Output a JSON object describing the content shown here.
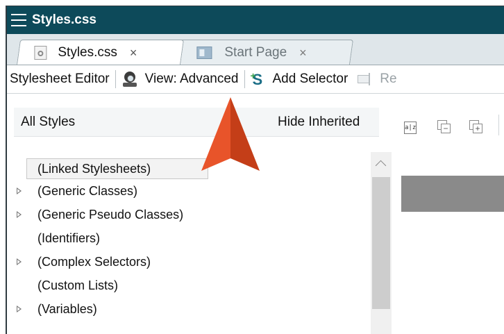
{
  "window": {
    "title": "Styles.css"
  },
  "tabs": [
    {
      "label": "Styles.css",
      "close": "×",
      "icon": "css-file-icon",
      "active": true
    },
    {
      "label": "Start Page",
      "close": "×",
      "icon": "start-page-icon",
      "active": false
    }
  ],
  "toolbar": {
    "stylesheet_editor": "Stylesheet Editor",
    "view_label": "View: Advanced",
    "add_selector": "Add Selector",
    "rename_partial": "Re"
  },
  "filter": {
    "value": "All Styles",
    "hide_inherited": "Hide Inherited",
    "sort_icon_text": "a|z"
  },
  "tree": {
    "items": [
      {
        "label": "(Linked Stylesheets)",
        "expandable": false,
        "selected": true
      },
      {
        "label": "(Generic Classes)",
        "expandable": true
      },
      {
        "label": "(Generic Pseudo Classes)",
        "expandable": true
      },
      {
        "label": "(Identifiers)",
        "expandable": false
      },
      {
        "label": "(Complex Selectors)",
        "expandable": true
      },
      {
        "label": "(Custom Lists)",
        "expandable": false
      },
      {
        "label": "(Variables)",
        "expandable": true
      }
    ]
  },
  "colors": {
    "titlebar": "#0d4a5a",
    "annotation_arrow": "#e8542a",
    "annotation_arrow_shadow": "#c43e18"
  }
}
